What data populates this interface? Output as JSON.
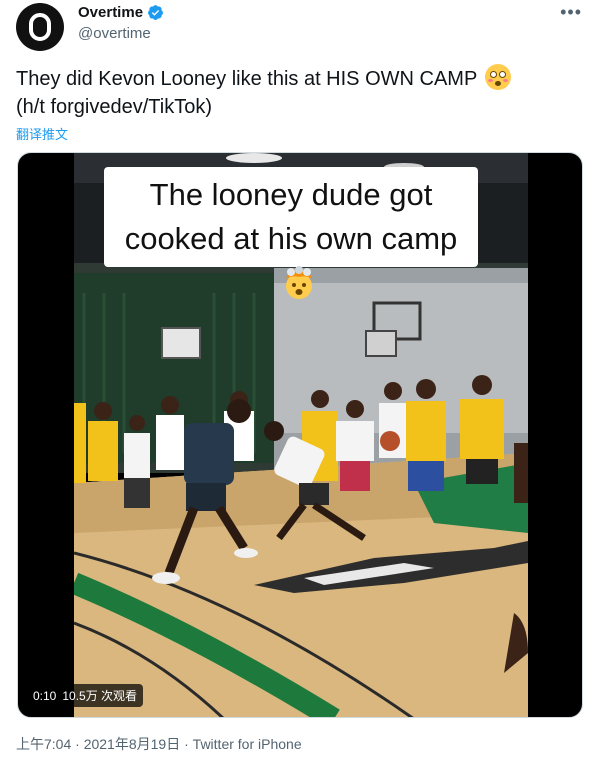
{
  "author": {
    "display_name": "Overtime",
    "handle": "@overtime"
  },
  "tweet": {
    "text_line1": "They did Kevon Looney like this at HIS OWN CAMP",
    "text_line2": "(h/t forgivedev/TikTok)",
    "translate_label": "翻译推文"
  },
  "video": {
    "caption_line1": "The looney dude got",
    "caption_line2": "cooked at his own camp",
    "timestamp": "0:10",
    "views": "10.5万 次观看"
  },
  "footer": {
    "time": "上午7:04",
    "separator": " · ",
    "date": "2021年8月19日",
    "source": "Twitter for iPhone"
  },
  "colors": {
    "accent": "#1d9bf0",
    "secondary_text": "#536471",
    "jersey_yellow": "#f2c21b"
  },
  "icons": {
    "verified": "verified-badge-icon",
    "more": "more-dots-icon",
    "emoji": "flushed-face-emoji",
    "exploding_head": "exploding-head-emoji"
  }
}
